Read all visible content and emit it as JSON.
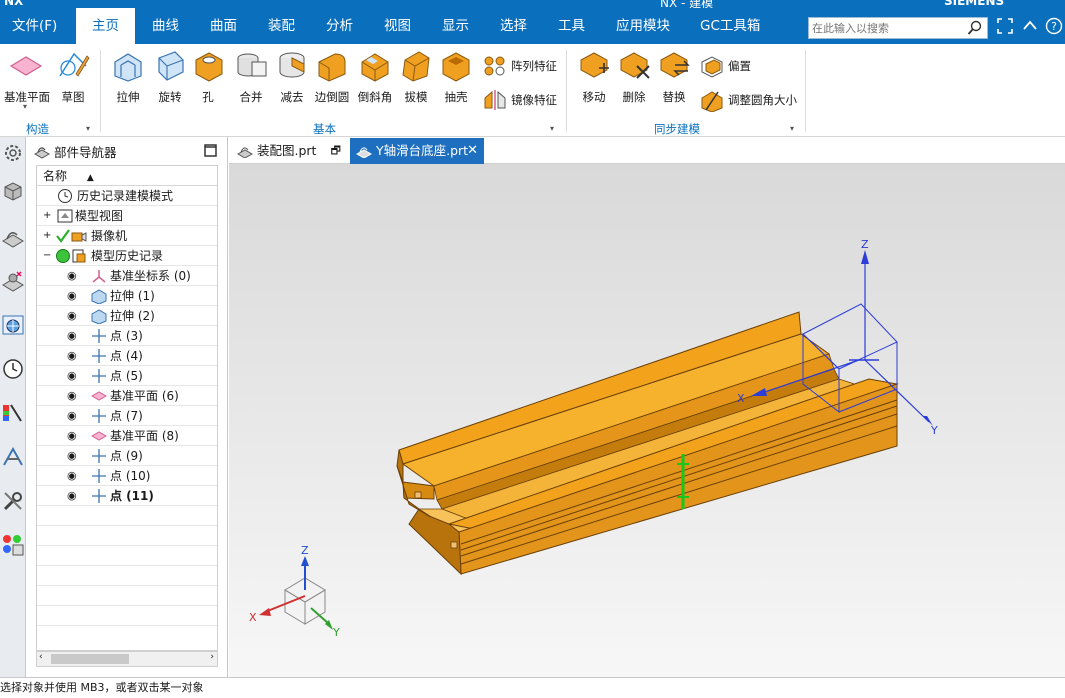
{
  "window": {
    "title": "NX - 建模",
    "app_logo": "NX",
    "brand": "SIEMENS"
  },
  "menu": {
    "file": "文件(F)",
    "items": [
      "主页",
      "曲线",
      "曲面",
      "装配",
      "分析",
      "视图",
      "显示",
      "选择",
      "工具",
      "应用模块",
      "GC工具箱"
    ],
    "search_placeholder": "在此输入以搜索"
  },
  "ribbon": {
    "construct": {
      "items": [
        "基准平面",
        "草图"
      ],
      "label": "构造"
    },
    "basic": {
      "items": [
        "拉伸",
        "旋转",
        "孔",
        "合并",
        "减去",
        "边倒圆",
        "倒斜角",
        "拔模",
        "抽壳"
      ],
      "small": [
        "阵列特征",
        "镜像特征"
      ],
      "label": "基本"
    },
    "sync": {
      "items": [
        "移动",
        "删除",
        "替换"
      ],
      "small": [
        "偏置",
        "调整圆角大小"
      ],
      "label": "同步建模"
    }
  },
  "navigator": {
    "title": "部件导航器",
    "column": "名称",
    "rows": [
      {
        "label": "历史记录建模模式"
      },
      {
        "label": "模型视图"
      },
      {
        "label": "摄像机"
      },
      {
        "label": "模型历史记录"
      },
      {
        "label": "基准坐标系 (0)"
      },
      {
        "label": "拉伸 (1)"
      },
      {
        "label": "拉伸 (2)"
      },
      {
        "label": "点 (3)"
      },
      {
        "label": "点 (4)"
      },
      {
        "label": "点 (5)"
      },
      {
        "label": "基准平面 (6)"
      },
      {
        "label": "点 (7)"
      },
      {
        "label": "基准平面 (8)"
      },
      {
        "label": "点 (9)"
      },
      {
        "label": "点 (10)"
      },
      {
        "label": "点 (11)"
      }
    ]
  },
  "tabs": [
    {
      "label": "装配图.prt"
    },
    {
      "label": "Y轴滑台底座.prt"
    }
  ],
  "viewport": {
    "csys_labels": {
      "x": "X",
      "y": "Y",
      "z": "Z"
    },
    "triad_labels": {
      "x": "X",
      "y": "Y",
      "z": "Z"
    }
  },
  "status": {
    "text": "选择对象并使用 MB3，或者双击某一对象"
  },
  "colors": {
    "brand": "#0a6fbd",
    "part": "#f0a020",
    "tab_active": "#1e6fc0"
  }
}
